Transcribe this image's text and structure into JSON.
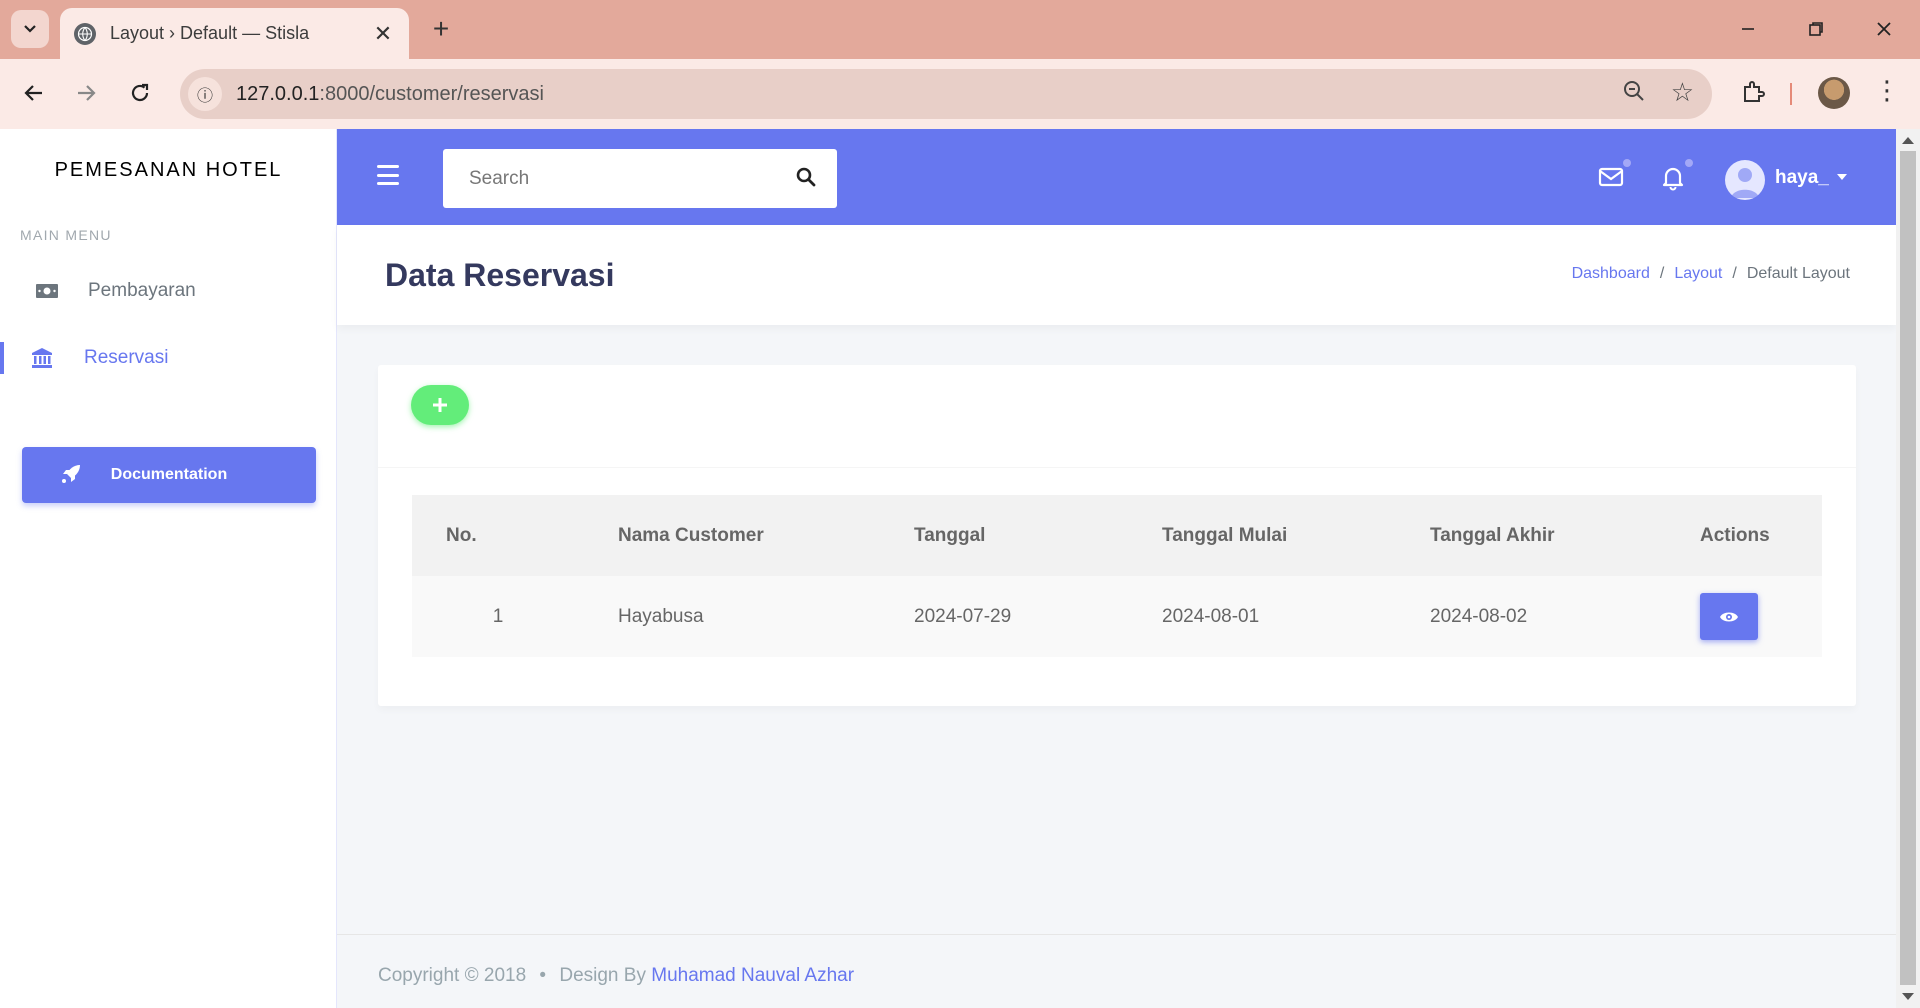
{
  "browser": {
    "tab_title": "Layout › Default — Stisla",
    "url_host": "127.0.0.1",
    "url_path": ":8000/customer/reservasi",
    "new_tab_label": "+"
  },
  "sidebar": {
    "brand": "PEMESANAN HOTEL",
    "menu_header": "MAIN MENU",
    "items": [
      {
        "label": "Pembayaran",
        "icon": "money-icon",
        "active": false
      },
      {
        "label": "Reservasi",
        "icon": "bank-icon",
        "active": true
      }
    ],
    "doc_button": "Documentation"
  },
  "topbar": {
    "search_placeholder": "Search",
    "user_name": "haya_"
  },
  "section": {
    "title": "Data Reservasi",
    "breadcrumb": [
      "Dashboard",
      "Layout",
      "Default Layout"
    ]
  },
  "table": {
    "headers": [
      "No.",
      "Nama Customer",
      "Tanggal",
      "Tanggal Mulai",
      "Tanggal Akhir",
      "Actions"
    ],
    "rows": [
      {
        "no": "1",
        "nama": "Hayabusa",
        "tanggal": "2024-07-29",
        "mulai": "2024-08-01",
        "akhir": "2024-08-02"
      }
    ]
  },
  "footer": {
    "copyright": "Copyright © 2018",
    "bullet": "•",
    "design_by": "Design By",
    "author": "Muhamad Nauval Azhar"
  },
  "colors": {
    "primary": "#6777ef",
    "success": "#63ed7a",
    "browser_frame": "#e3a99b"
  }
}
